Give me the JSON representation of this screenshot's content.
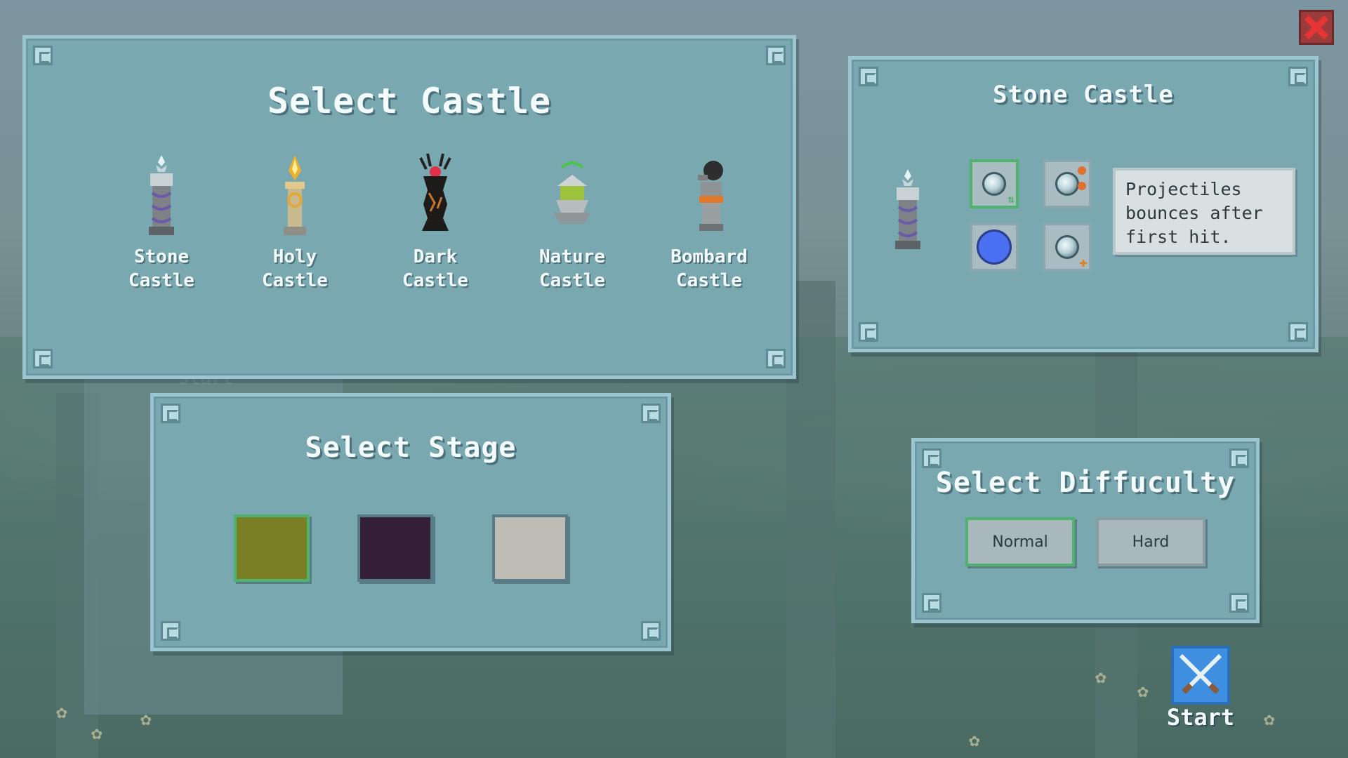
{
  "castle_panel": {
    "title": "Select Castle",
    "castles": [
      {
        "line1": "Stone",
        "line2": "Castle",
        "icon": "stone-tower-icon"
      },
      {
        "line1": "Holy",
        "line2": "Castle",
        "icon": "holy-tower-icon"
      },
      {
        "line1": "Dark",
        "line2": "Castle",
        "icon": "dark-tower-icon"
      },
      {
        "line1": "Nature",
        "line2": "Castle",
        "icon": "nature-tower-icon"
      },
      {
        "line1": "Bombard",
        "line2": "Castle",
        "icon": "bombard-tower-icon"
      }
    ]
  },
  "detail_panel": {
    "title": "Stone Castle",
    "description": "Projectiles bounces after first hit.",
    "upgrades": [
      "bounce-upgrade-icon",
      "multishot-upgrade-icon",
      "blue-orb-upgrade-icon",
      "add-projectile-upgrade-icon"
    ]
  },
  "stage_panel": {
    "title": "Select Stage",
    "stages": [
      {
        "color": "#7a7f25",
        "selected": true
      },
      {
        "color": "#35203a",
        "selected": false
      },
      {
        "color": "#bdbcb5",
        "selected": false
      }
    ]
  },
  "difficulty_panel": {
    "title": "Select Diffuculty",
    "options": [
      "Normal",
      "Hard"
    ],
    "selected": "Normal"
  },
  "start_button": {
    "label": "Start",
    "icon": "crossed-swords-icon"
  },
  "background": {
    "ghost_text": "Start"
  },
  "colors": {
    "panel": "#79a8b1",
    "selected_border": "#4fb36f",
    "close": "#d93030"
  }
}
